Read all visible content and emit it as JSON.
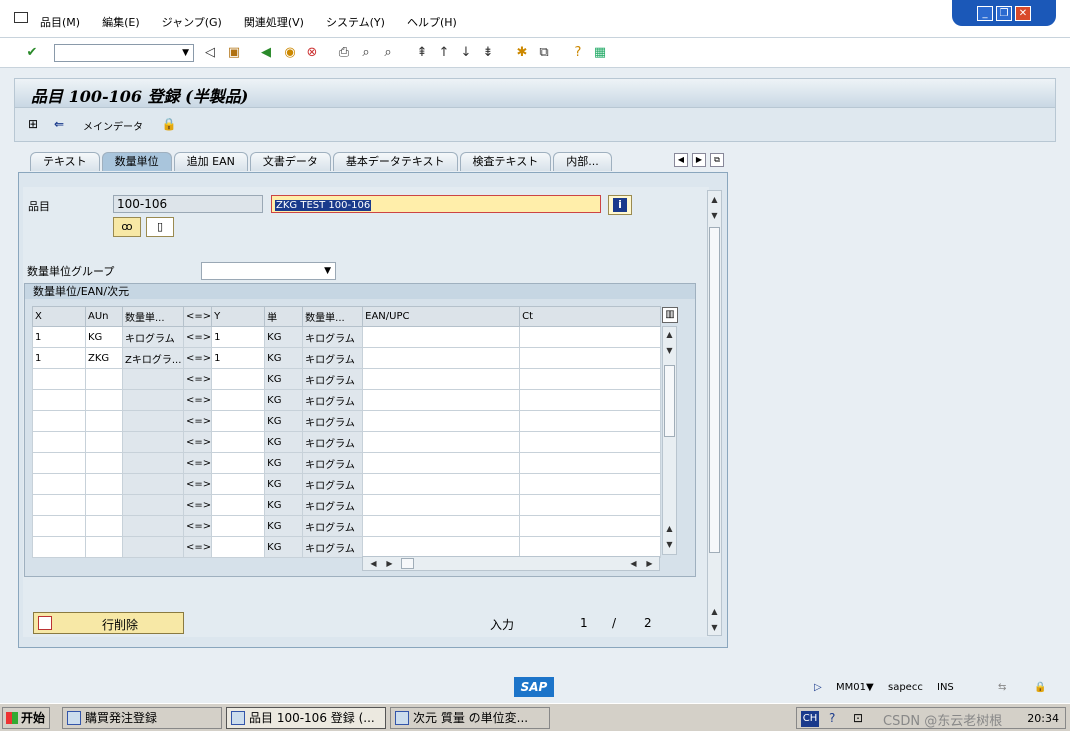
{
  "menu": {
    "items": [
      "品目(M)",
      "編集(E)",
      "ジャンプ(G)",
      "関連処理(V)",
      "システム(Y)",
      "ヘルプ(H)"
    ]
  },
  "window_controls": {
    "minimize": "_",
    "restore": "❐",
    "close": "✕"
  },
  "toolbar": {
    "command_field_value": ""
  },
  "title": "品目 100-106 登録 (半製品)",
  "app_toolbar": {
    "main_data_label": "メインデータ"
  },
  "tabs": [
    {
      "label": "テキスト",
      "active": false
    },
    {
      "label": "数量単位",
      "active": true
    },
    {
      "label": "追加 EAN",
      "active": false
    },
    {
      "label": "文書データ",
      "active": false
    },
    {
      "label": "基本データテキスト",
      "active": false
    },
    {
      "label": "検査テキスト",
      "active": false
    },
    {
      "label": "内部...",
      "active": false
    }
  ],
  "form": {
    "material_label": "品目",
    "material_value": "100-106",
    "description_value": "ZKG TEST 100-106",
    "uom_group_label": "数量単位グループ",
    "uom_group_value": ""
  },
  "group": {
    "title": "数量単位/EAN/次元",
    "columns": [
      "X",
      "AUn",
      "数量単...",
      "<=>",
      "Y",
      "単",
      "数量単...",
      "EAN/UPC",
      "Ct"
    ],
    "rows": [
      [
        "1",
        "KG",
        "キログラム",
        "<=>",
        "1",
        "KG",
        "キログラム",
        "",
        ""
      ],
      [
        "1",
        "ZKG",
        "Zキログラ...",
        "<=>",
        "1",
        "KG",
        "キログラム",
        "",
        ""
      ],
      [
        "",
        "",
        "",
        "<=>",
        "",
        "KG",
        "キログラム",
        "",
        ""
      ],
      [
        "",
        "",
        "",
        "<=>",
        "",
        "KG",
        "キログラム",
        "",
        ""
      ],
      [
        "",
        "",
        "",
        "<=>",
        "",
        "KG",
        "キログラム",
        "",
        ""
      ],
      [
        "",
        "",
        "",
        "<=>",
        "",
        "KG",
        "キログラム",
        "",
        ""
      ],
      [
        "",
        "",
        "",
        "<=>",
        "",
        "KG",
        "キログラム",
        "",
        ""
      ],
      [
        "",
        "",
        "",
        "<=>",
        "",
        "KG",
        "キログラム",
        "",
        ""
      ],
      [
        "",
        "",
        "",
        "<=>",
        "",
        "KG",
        "キログラム",
        "",
        ""
      ],
      [
        "",
        "",
        "",
        "<=>",
        "",
        "KG",
        "キログラム",
        "",
        ""
      ],
      [
        "",
        "",
        "",
        "<=>",
        "",
        "KG",
        "キログラム",
        "",
        ""
      ]
    ]
  },
  "footer": {
    "delete_row_label": "行削除",
    "entry_label": "入力",
    "entry_current": "1",
    "entry_separator": "/",
    "entry_total": "2"
  },
  "statusbar": {
    "sap_logo": "SAP",
    "transaction": "MM01",
    "server": "sapecc",
    "mode": "INS"
  },
  "taskbar": {
    "start_label": "开始",
    "tasks": [
      "購買発注登録",
      "品目 100-106 登録 (...",
      "次元 質量 の単位変..."
    ],
    "lang": "CH",
    "watermark": "CSDN @东云老树根",
    "clock": "20:34"
  }
}
